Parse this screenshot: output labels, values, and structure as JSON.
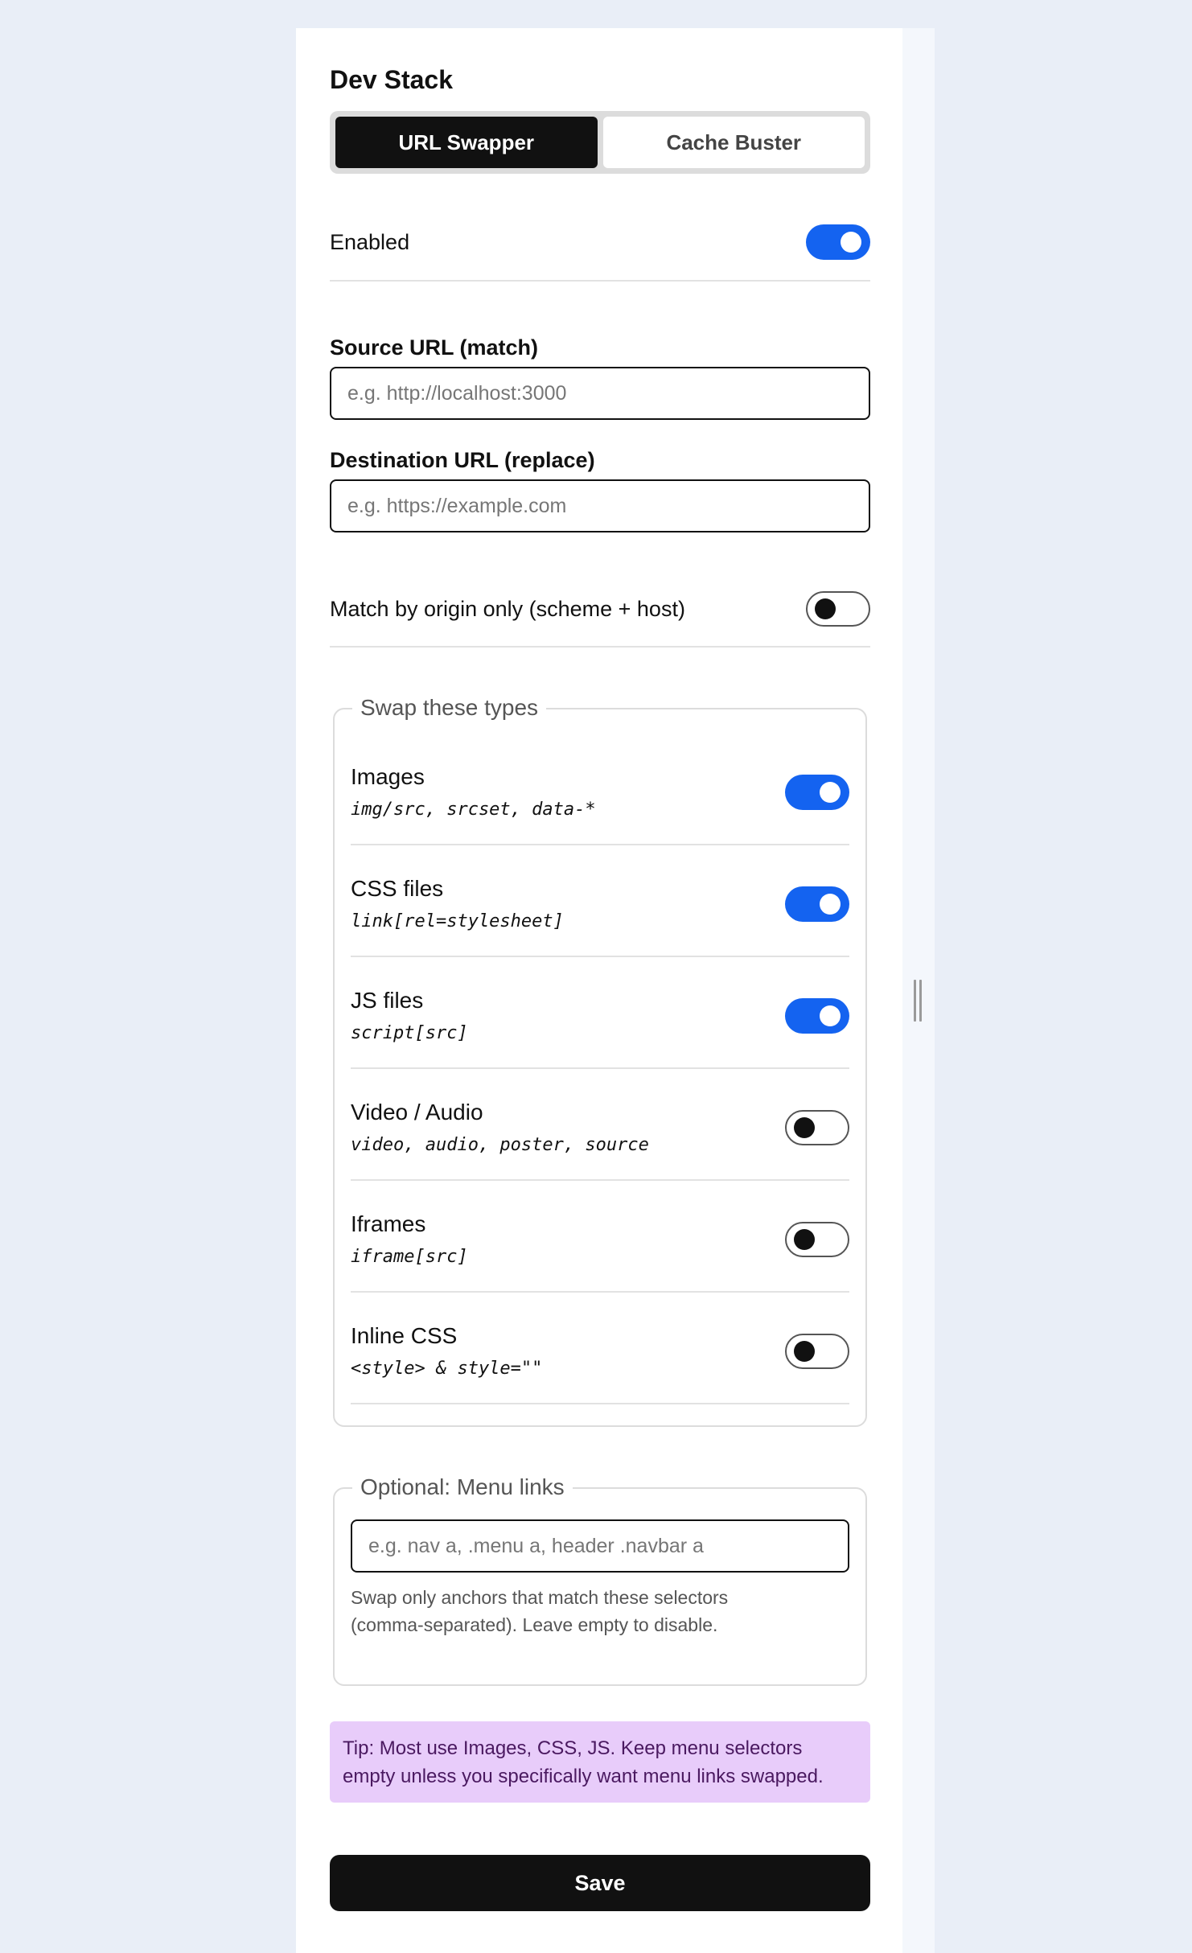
{
  "app": {
    "title": "Dev Stack"
  },
  "tabs": [
    {
      "label": "URL Swapper",
      "active": true
    },
    {
      "label": "Cache Buster",
      "active": false
    }
  ],
  "enabled": {
    "label": "Enabled",
    "value": true
  },
  "source": {
    "label": "Source URL (match)",
    "placeholder": "e.g. http://localhost:3000",
    "value": ""
  },
  "destination": {
    "label": "Destination URL (replace)",
    "placeholder": "e.g. https://example.com",
    "value": ""
  },
  "origin_only": {
    "label": "Match by origin only (scheme + host)",
    "value": false
  },
  "types": {
    "legend": "Swap these types",
    "items": [
      {
        "title": "Images",
        "sub": "img/src, srcset, data-*",
        "value": true
      },
      {
        "title": "CSS files",
        "sub": "link[rel=stylesheet]",
        "value": true
      },
      {
        "title": "JS files",
        "sub": "script[src]",
        "value": true
      },
      {
        "title": "Video / Audio",
        "sub": "video, audio, poster, source",
        "value": false
      },
      {
        "title": "Iframes",
        "sub": "iframe[src]",
        "value": false
      },
      {
        "title": "Inline CSS",
        "sub": "<style> & style=\"\"",
        "value": false
      }
    ]
  },
  "menu": {
    "legend": "Optional: Menu links",
    "placeholder": "e.g. nav a, .menu a, header .navbar a",
    "value": "",
    "help_line1": "Swap only anchors that match these selectors",
    "help_line2": "(comma-separated). Leave empty to disable."
  },
  "tip": {
    "line1": "Tip: Most use Images, CSS, JS. Keep menu selectors",
    "line2": "empty unless you specifically want menu links swapped."
  },
  "save": {
    "label": "Save"
  },
  "colors": {
    "accent": "#1463f0",
    "dark": "#111111",
    "tip_bg": "#e8ccfa",
    "background": "#e9eef7"
  }
}
